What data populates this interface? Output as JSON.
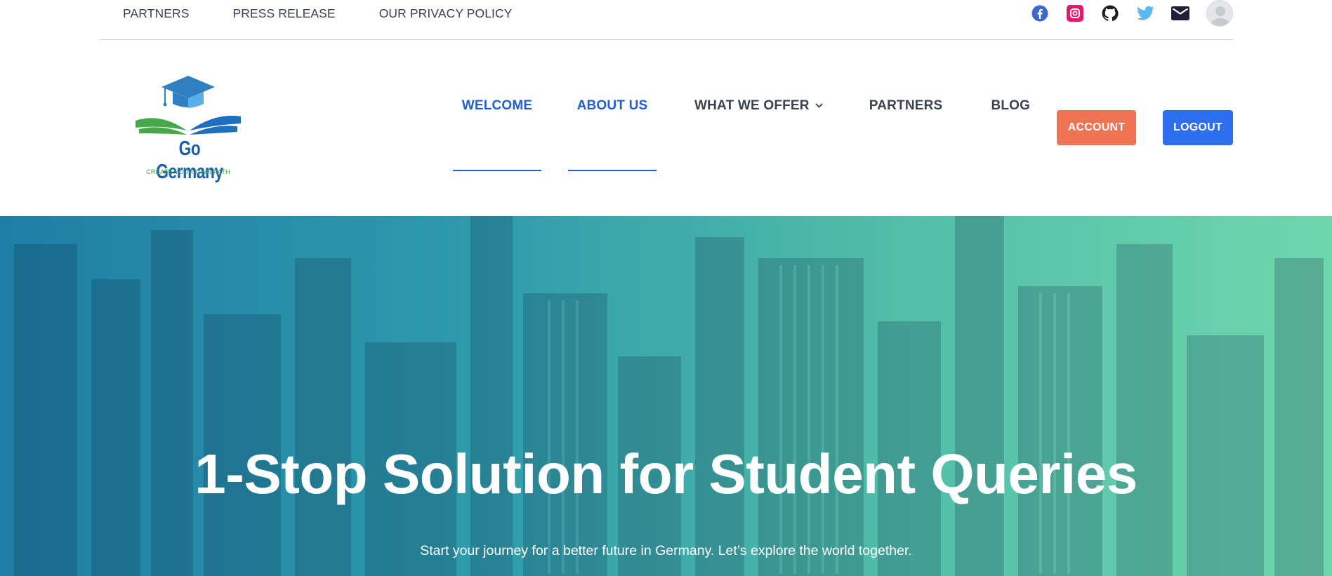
{
  "topbar": {
    "links": [
      "PARTNERS",
      "PRESS RELEASE",
      "OUR PRIVACY POLICY"
    ],
    "social_icons": [
      "facebook-icon",
      "instagram-icon",
      "github-icon",
      "twitter-icon",
      "mail-icon"
    ]
  },
  "logo": {
    "name": "Go Germany",
    "tagline": "CREATE YOUR OWN PATH"
  },
  "nav": {
    "welcome": "WELCOME",
    "about": "ABOUT US",
    "offer": "WHAT WE OFFER",
    "partners": "PARTNERS",
    "blog": "BLOG"
  },
  "buttons": {
    "account": "ACCOUNT",
    "logout": "LOGOUT"
  },
  "hero": {
    "title": "1-Stop Solution for Student Queries",
    "subtitle": "Start your journey for a better future in Germany. Let’s explore the world together."
  },
  "colors": {
    "nav_active": "#1f5fd4",
    "account_button": "#ef7454",
    "logout_button": "#2d6ff0",
    "hero_gradient_start": "#1f7ea5",
    "hero_gradient_end": "#6fd6ad"
  }
}
